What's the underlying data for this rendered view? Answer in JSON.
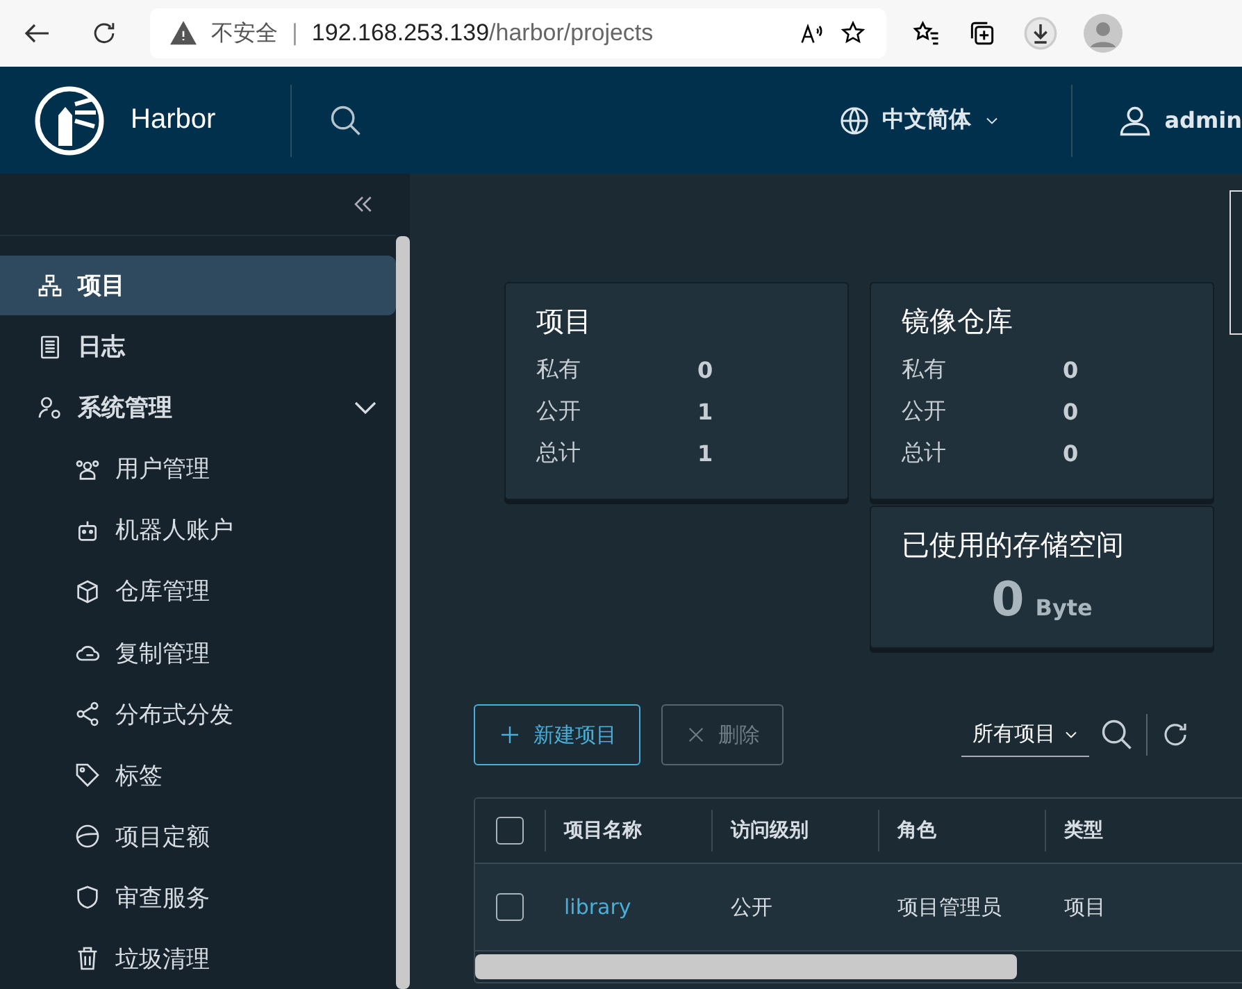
{
  "browser": {
    "security_label": "不安全",
    "separator": "|",
    "url_host": "192.168.253.139",
    "url_path": "/harbor/projects"
  },
  "header": {
    "brand": "Harbor",
    "language": "中文简体",
    "user": "admin"
  },
  "sidebar": {
    "items": [
      {
        "label": "项目",
        "selected": true
      },
      {
        "label": "日志",
        "selected": false
      },
      {
        "label": "系统管理",
        "selected": false,
        "expanded": true,
        "children": [
          {
            "label": "用户管理",
            "selected": false
          },
          {
            "label": "机器人账户",
            "selected": false
          },
          {
            "label": "仓库管理",
            "selected": false
          },
          {
            "label": "复制管理",
            "selected": false
          },
          {
            "label": "分布式分发",
            "selected": false
          },
          {
            "label": "标签",
            "selected": false
          },
          {
            "label": "项目定额",
            "selected": false
          },
          {
            "label": "审查服务",
            "selected": false
          },
          {
            "label": "垃圾清理",
            "selected": false
          }
        ]
      }
    ]
  },
  "summary": {
    "projects": {
      "title": "项目",
      "rows": [
        {
          "label": "私有",
          "value": "0"
        },
        {
          "label": "公开",
          "value": "1"
        },
        {
          "label": "总计",
          "value": "1"
        }
      ]
    },
    "repositories": {
      "title": "镜像仓库",
      "rows": [
        {
          "label": "私有",
          "value": "0"
        },
        {
          "label": "公开",
          "value": "0"
        },
        {
          "label": "总计",
          "value": "0"
        }
      ]
    },
    "storage": {
      "title": "已使用的存储空间",
      "value": "0",
      "unit": "Byte"
    }
  },
  "toolbar": {
    "new_button": "新建项目",
    "delete_button": "删除",
    "delete_disabled": true,
    "filter": "所有项目"
  },
  "table": {
    "all_checked": false,
    "columns": [
      "项目名称",
      "访问级别",
      "角色",
      "类型"
    ],
    "rows": [
      {
        "checked": false,
        "cells": [
          "library",
          "公开",
          "项目管理员",
          "项目"
        ]
      }
    ]
  }
}
